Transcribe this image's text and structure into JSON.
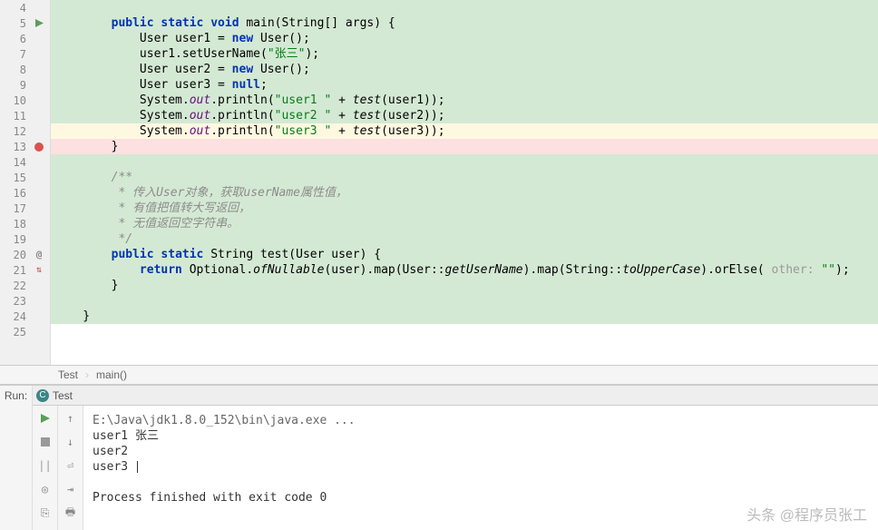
{
  "gutter": {
    "lines": [
      4,
      5,
      6,
      7,
      8,
      9,
      10,
      11,
      12,
      13,
      14,
      15,
      16,
      17,
      18,
      19,
      20,
      21,
      22,
      23,
      24,
      25
    ]
  },
  "code": {
    "l4": "",
    "l5_kw_public": "public",
    "l5_kw_static": "static",
    "l5_kw_void": "void",
    "l5_main": " main(String[] args) {",
    "l6_pre": "            User user1 = ",
    "l6_new": "new",
    "l6_post": " User();",
    "l7_pre": "            user1.setUserName(",
    "l7_str": "\"张三\"",
    "l7_post": ");",
    "l8_pre": "            User user2 = ",
    "l8_new": "new",
    "l8_post": " User();",
    "l9_pre": "            User user3 = ",
    "l9_null": "null",
    "l9_post": ";",
    "l10_pre": "            System.",
    "l10_out": "out",
    "l10_print": ".println(",
    "l10_str": "\"user1 \"",
    "l10_plus": " + ",
    "l10_test": "test",
    "l10_post": "(user1));",
    "l11_str": "\"user2 \"",
    "l11_post": "(user2));",
    "l12_str": "\"user3 \"",
    "l12_post": "(user3));",
    "l13": "        }",
    "l15": "        /**",
    "l16": "         * 传入User对象，获取userName属性值，",
    "l17": "         * 有值把值转大写返回，",
    "l18": "         * 无值返回空字符串。",
    "l19": "         */",
    "l20_pre": "        ",
    "l20_kw_public": "public",
    "l20_kw_static": "static",
    "l20_sig": " String test(User user) {",
    "l21_pre": "            ",
    "l21_return": "return",
    "l21_opt": " Optional.",
    "l21_ofnull": "ofNullable",
    "l21_mid1": "(user).map(User::",
    "l21_getun": "getUserName",
    "l21_mid2": ").map(String::",
    "l21_upper": "toUpperCase",
    "l21_orelse": ").orElse(",
    "l21_hint": " other: ",
    "l21_empty": "\"\"",
    "l21_end": ");",
    "l22": "        }",
    "l24": "    }"
  },
  "breadcrumb": {
    "item1": "Test",
    "sep": "›",
    "item2": "main()"
  },
  "run": {
    "label": "Run:",
    "tab": "Test",
    "output_path": "E:\\Java\\jdk1.8.0_152\\bin\\java.exe ...",
    "out1": "user1 张三",
    "out2": "user2",
    "out3": "user3 ",
    "exit": "Process finished with exit code 0"
  },
  "watermark": "头条 @程序员张工"
}
